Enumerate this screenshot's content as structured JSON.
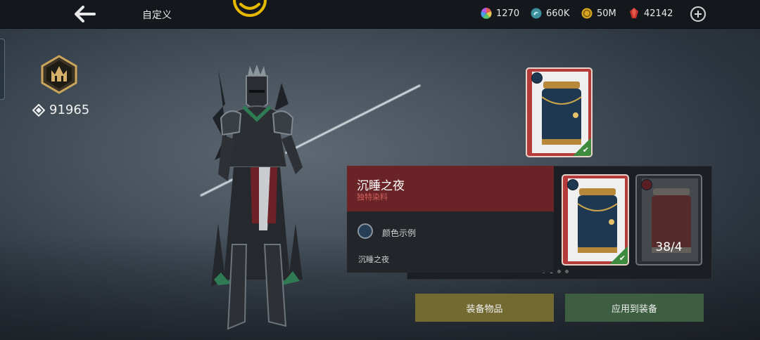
{
  "header": {
    "title": "自定义",
    "back_icon": "arrow-left-icon",
    "emblem_icon": "smile-emblem-icon"
  },
  "currencies": [
    {
      "icon": "rainbow-gem-icon",
      "value": "1270"
    },
    {
      "icon": "teal-orb-icon",
      "value": "660K"
    },
    {
      "icon": "gold-coin-icon",
      "value": "50M"
    },
    {
      "icon": "red-crystal-icon",
      "value": "42142"
    }
  ],
  "player": {
    "rank_icon": "crown-crest-icon",
    "power": "91965"
  },
  "selected_item": {
    "name": "沉睡之夜",
    "type": "独特染料",
    "color_example_label": "颜色示例",
    "color_name": "沉睡之夜"
  },
  "inventory": {
    "locked_count": "38/4",
    "page_index": 2,
    "page_total": 4
  },
  "actions": {
    "equip_label": "装备物品",
    "apply_label": "应用到装备"
  },
  "colors": {
    "card_red": "#b53a3a",
    "dye_blue": "#1d3850",
    "equip_button": "#736a32",
    "apply_button": "#3d5e41",
    "info_header": "#6a2427"
  }
}
